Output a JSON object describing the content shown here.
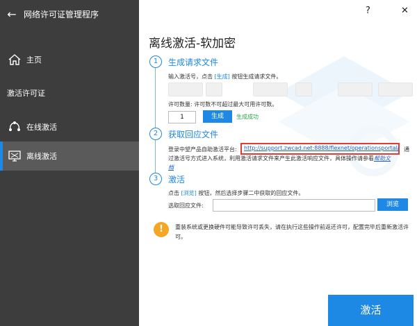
{
  "app": {
    "title": "网络许可证管理程序",
    "back_icon": "back-arrow-icon"
  },
  "sidebar": {
    "items": [
      {
        "label": "主页",
        "icon": "home-icon"
      },
      {
        "label": "激活许可证",
        "icon": ""
      },
      {
        "label": "在线激活",
        "icon": "network-icon"
      },
      {
        "label": "离线激活",
        "icon": "monitor-icon",
        "active": true
      }
    ]
  },
  "window": {
    "help": "?",
    "close": "✕"
  },
  "page": {
    "title": "离线激活-软加密"
  },
  "steps": [
    {
      "num": "1",
      "title": "生成请求文件",
      "instr_prefix": "输入激活号，点击 ",
      "instr_btn": "[生成]",
      "instr_suffix": " 按钮生成请求文件。",
      "qty_label": "许可数量:",
      "qty_hint": "许可数不可超过最大可用许可数。",
      "qty_value": "1",
      "generate_label": "生成",
      "status": "生成成功"
    },
    {
      "num": "2",
      "title": "获取回应文件",
      "line1_prefix": "登录中望产品自助激活平台:",
      "url": "http://support.zwcad.net:8888/flexnet/operationsportal/",
      "line1_suffix": "通",
      "line2": "过激活号方式进入系统，利用激活请求文件来产生此激活响应文件，具体操作请参看",
      "help_link_a": "帮助文",
      "help_link_b": "档"
    },
    {
      "num": "3",
      "title": "激活",
      "instr_prefix": "点击 ",
      "instr_btn": "[浏览]",
      "instr_suffix": " 按钮，然后选择步骤二中获取的回应文件。",
      "file_label": "选取回应文件:",
      "file_value": "",
      "browse_label": "浏览"
    }
  ],
  "warning": {
    "icon": "warning-icon",
    "text": "重装系统或更换硬件可能导致许可丢失，请在执行这些操作前返还许可，配置完毕后重新激活许可。"
  },
  "activate": {
    "label": "激活"
  },
  "colors": {
    "accent": "#1e88e5",
    "sidebar_bg": "#3d3d3d",
    "success": "#28a745",
    "warning": "#f5a623",
    "highlight": "#e53935"
  }
}
